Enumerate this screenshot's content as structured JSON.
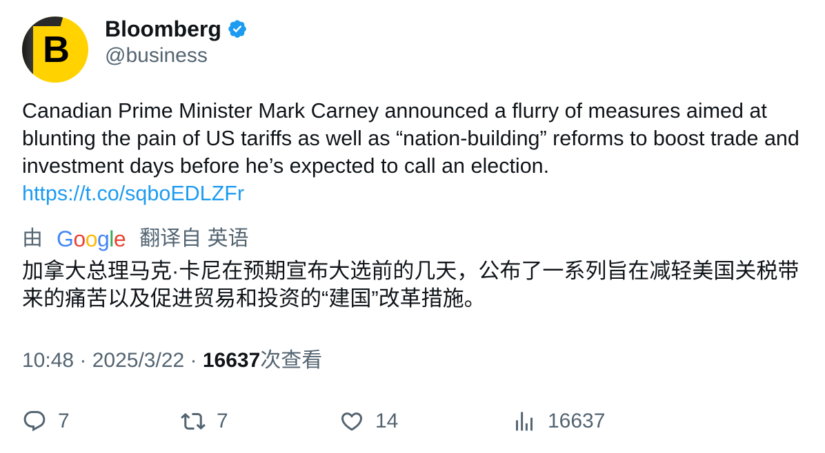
{
  "author": {
    "avatar_letter": "B",
    "name": "Bloomberg",
    "handle": "@business",
    "verified_icon": "verified-badge-icon"
  },
  "tweet": {
    "text": "Canadian Prime Minister Mark Carney announced a flurry of measures aimed at blunting the pain of US tariffs as well as “nation-building” reforms to boost trade and investment days before he’s expected to call an election.",
    "link": "https://t.co/sqboEDLZFr"
  },
  "translation": {
    "prefix": "由",
    "provider": "Google",
    "suffix": "翻译自 英语",
    "text": "加拿大总理马克·卡尼在预期宣布大选前的几天，公布了一系列旨在减轻美国关税带来的痛苦以及促进贸易和投资的“建国”改革措施。"
  },
  "meta": {
    "time_date": "10:48 · 2025/3/22 · ",
    "views_count": "16637",
    "views_label": "次查看"
  },
  "actions": {
    "replies": "7",
    "retweets": "7",
    "likes": "14",
    "views": "16637"
  },
  "colors": {
    "accent": "#1d9bf0",
    "secondary_text": "#536471",
    "avatar_bg": "#ffd200"
  }
}
